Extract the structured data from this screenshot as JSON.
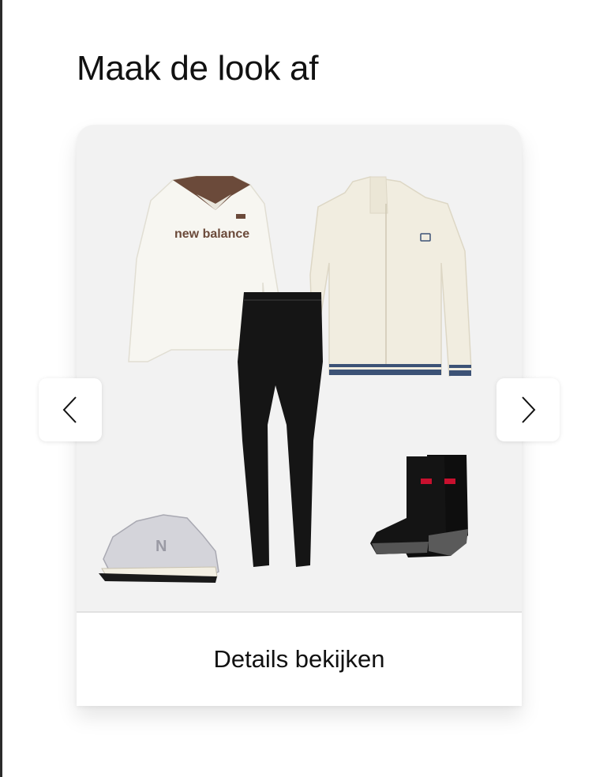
{
  "section": {
    "title": "Maak de look af"
  },
  "look": {
    "image_alt": "Outfit: wit longsleeve shirt met bruine kraag, zwarte legging, crème trainingsjack, zilveren sneakers en zwarte sokken",
    "shirt_logo_text": "new balance",
    "details_label": "Details bekijken"
  },
  "carousel": {
    "prev_icon": "chevron-left-icon",
    "next_icon": "chevron-right-icon"
  },
  "colors": {
    "title_text": "#111111",
    "image_background": "#f2f2f2",
    "shirt_collar": "#6b4a3a",
    "jacket": "#f1ede0",
    "jacket_stripe": "#3c5276",
    "sock_logo": "#c8102e"
  }
}
